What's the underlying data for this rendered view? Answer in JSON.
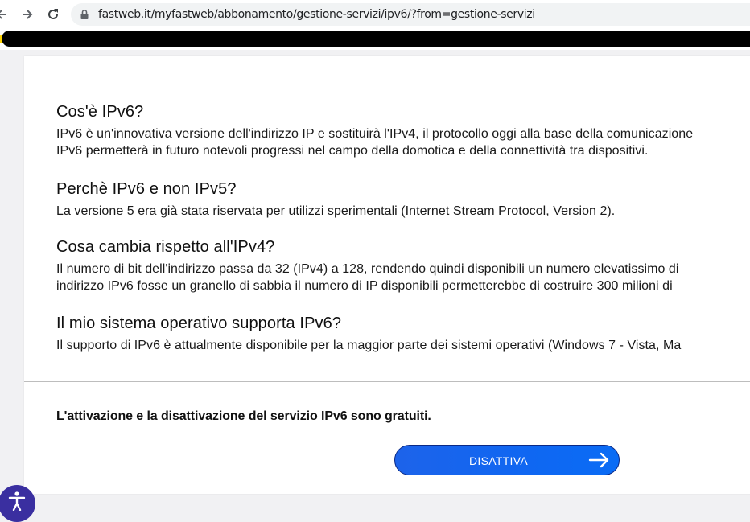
{
  "browser": {
    "url": "fastweb.it/myfastweb/abbonamento/gestione-servizi/ipv6/?from=gestione-servizi"
  },
  "faq": [
    {
      "question": "Cos'è IPv6?",
      "lines": [
        "IPv6 è un'innovativa versione dell'indirizzo IP e sostituirà l'IPv4, il protocollo oggi alla base della comunicazione",
        "IPv6 permetterà in futuro notevoli progressi nel campo della domotica e della connettività tra dispositivi."
      ]
    },
    {
      "question": "Perchè IPv6 e non IPv5?",
      "lines": [
        "La versione 5 era già stata riservata per utilizzi sperimentali (Internet Stream Protocol, Version 2)."
      ]
    },
    {
      "question": "Cosa cambia rispetto all'IPv4?",
      "lines": [
        "Il numero di bit dell'indirizzo passa da 32 (IPv4) a 128, rendendo quindi disponibili un numero elevatissimo di",
        "indirizzo IPv6 fosse un granello di sabbia il numero di IP disponibili permetterebbe di costruire 300 milioni di"
      ]
    },
    {
      "question": "Il mio sistema operativo supporta IPv6?",
      "lines": [
        "Il supporto di IPv6 è attualmente disponibile per la maggior parte dei sistemi operativi (Windows 7 - Vista, Ma"
      ]
    }
  ],
  "free_note": "L'attivazione e la disattivazione del servizio IPv6 sono gratuiti.",
  "cta": {
    "label": "DISATTIVA"
  },
  "icons": {
    "back": "arrow-left-icon",
    "forward": "arrow-right-icon",
    "reload": "reload-icon",
    "lock": "lock-icon",
    "cta_arrow": "arrow-right-icon",
    "accessibility": "accessibility-icon"
  },
  "colors": {
    "cta": "#0f67f2",
    "cta_border": "#0b2a86",
    "accessibility": "#3a2fa0",
    "divider": "#bdbdbd"
  }
}
